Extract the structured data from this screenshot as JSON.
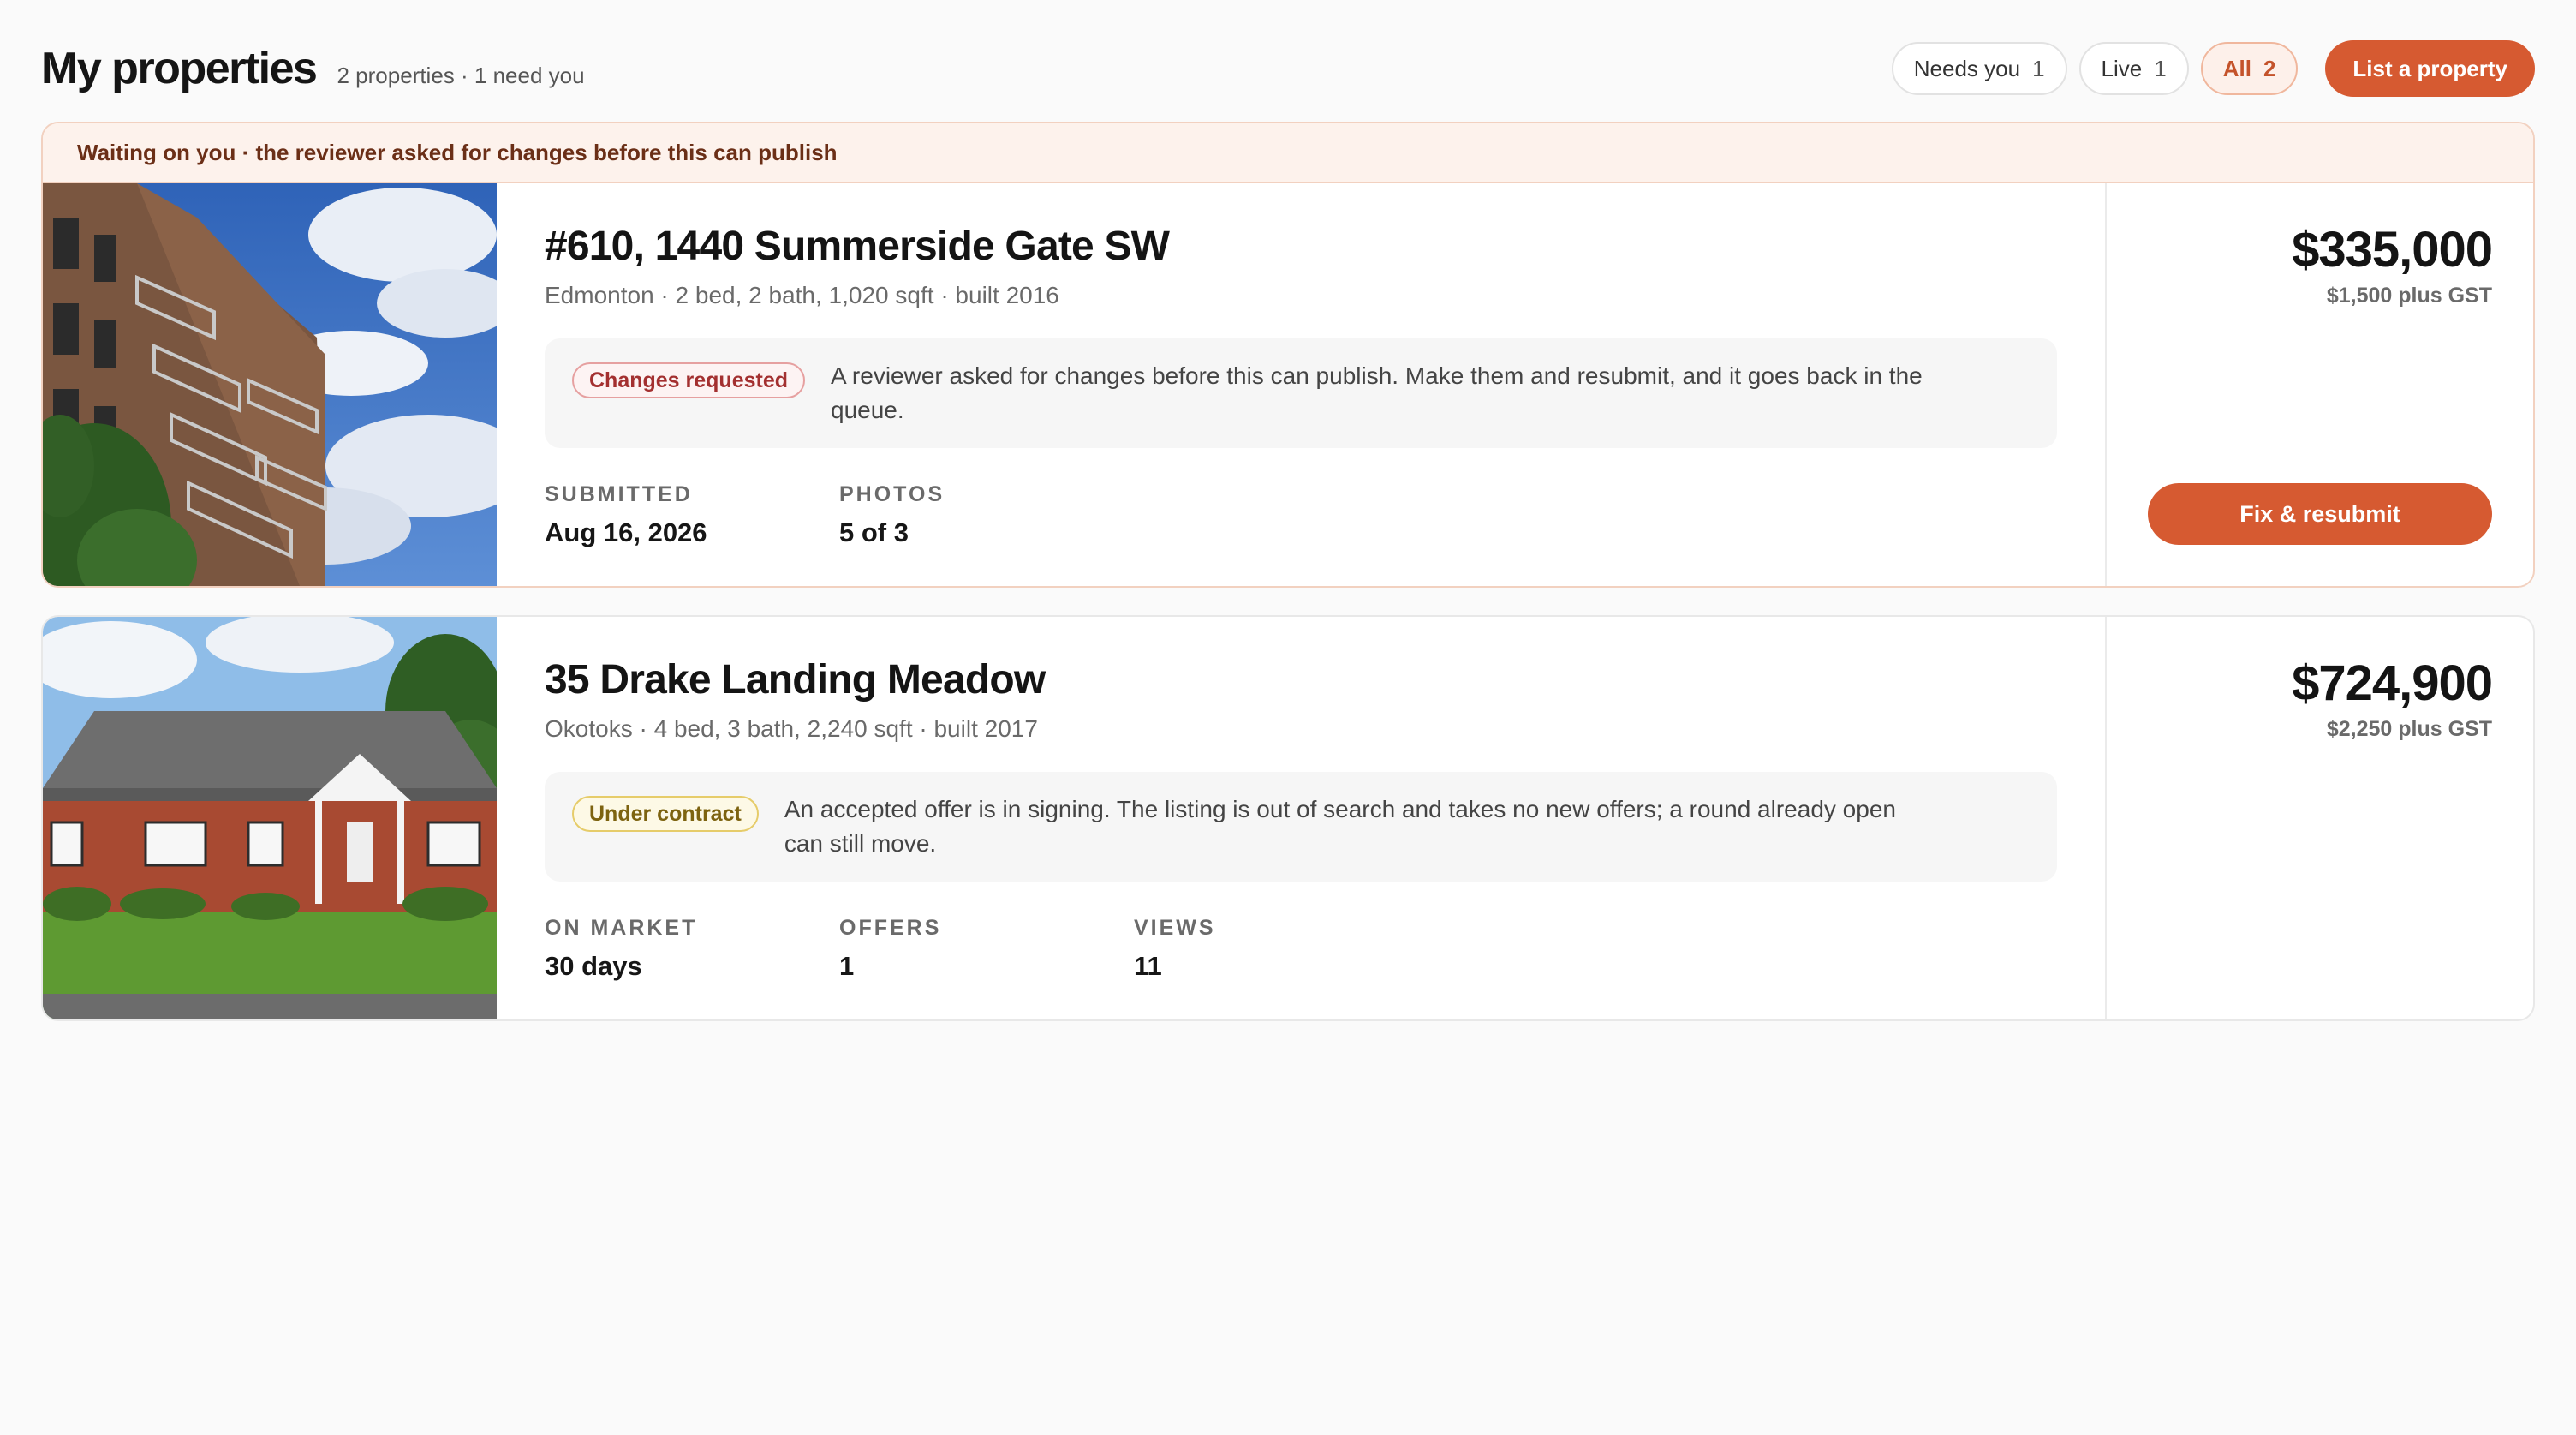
{
  "header": {
    "title": "My properties",
    "subtitle": "2 properties · 1 need you",
    "filters": [
      {
        "label": "Needs you",
        "count": "1"
      },
      {
        "label": "Live",
        "count": "1"
      },
      {
        "label": "All",
        "count": "2"
      }
    ],
    "active_filter": "All",
    "list_button": "List a property"
  },
  "listings": [
    {
      "banner": "Waiting on you · the reviewer asked for changes before this can publish",
      "title": "#610, 1440 Summerside Gate SW",
      "meta": "Edmonton · 2 bed, 2 bath, 1,020 sqft · built 2016",
      "badge": "Changes requested",
      "status_text": "A reviewer asked for changes before this can publish. Make them and resubmit, and it goes back in the queue.",
      "stats": [
        {
          "label": "SUBMITTED",
          "value": "Aug 16, 2026"
        },
        {
          "label": "PHOTOS",
          "value": "5 of 3"
        }
      ],
      "price": "$335,000",
      "fee": "$1,500 plus GST",
      "action": "Fix & resubmit"
    },
    {
      "title": "35 Drake Landing Meadow",
      "meta": "Okotoks · 4 bed, 3 bath, 2,240 sqft · built 2017",
      "badge": "Under contract",
      "status_text": "An accepted offer is in signing. The listing is out of search and takes no new offers; a round already open can still move.",
      "stats": [
        {
          "label": "ON MARKET",
          "value": "30 days"
        },
        {
          "label": "OFFERS",
          "value": "1"
        },
        {
          "label": "VIEWS",
          "value": "11"
        }
      ],
      "price": "$724,900",
      "fee": "$2,250 plus GST"
    }
  ],
  "colors": {
    "accent": "#d65a31",
    "banner_bg": "#fdf2ec",
    "badge_red": "#a33030",
    "badge_yellow": "#7d6310"
  }
}
